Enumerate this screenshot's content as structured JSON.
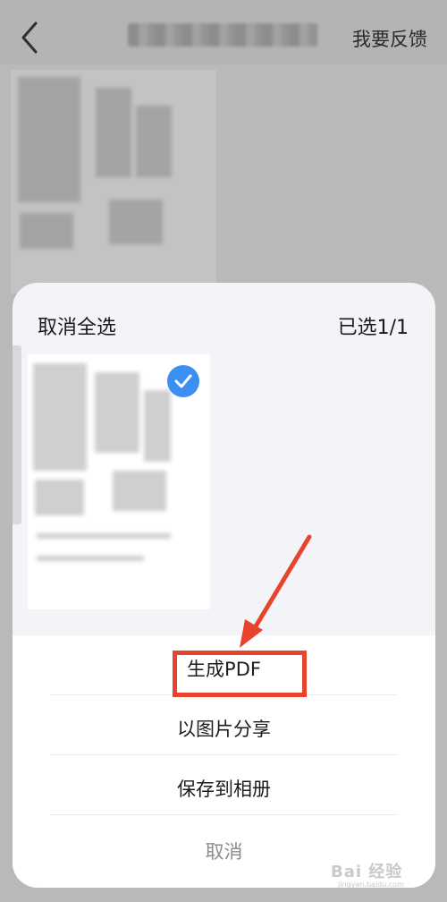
{
  "topbar": {
    "feedback_label": "我要反馈"
  },
  "sheet": {
    "deselect_all_label": "取消全选",
    "selected_count": "已选1/1",
    "actions": [
      {
        "label": "生成PDF"
      },
      {
        "label": "以图片分享"
      },
      {
        "label": "保存到相册"
      }
    ],
    "cancel_label": "取消"
  },
  "colors": {
    "accent_blue": "#3b8ff3",
    "annotation_red": "#e8432c"
  },
  "watermark": {
    "text": "Bai 经验",
    "sub": "jingyan.baidu.com"
  }
}
